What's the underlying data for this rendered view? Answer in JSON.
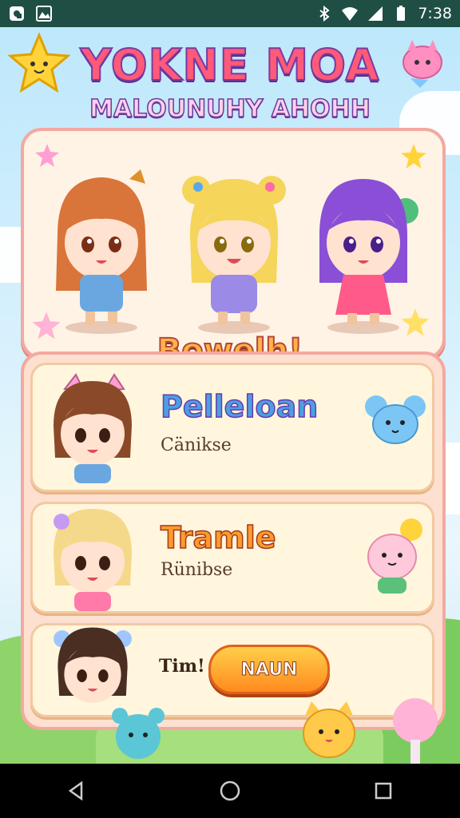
{
  "status_bar": {
    "time": "7:38",
    "icons": [
      "notification-icon",
      "gallery-icon",
      "bluetooth-icon",
      "wifi-icon",
      "signal-icon",
      "battery-icon"
    ]
  },
  "game": {
    "title": "YOKNE MOA",
    "subtitle": "MALOUNUHY AHOHH",
    "banner": "Bowelh!",
    "cards": [
      {
        "title": "Pelleloan",
        "subtitle": "Cänikse"
      },
      {
        "title": "Tramle",
        "subtitle": "Rünibse"
      },
      {
        "label": "Tim!",
        "button": "NAUN"
      }
    ]
  },
  "colors": {
    "accent": "#ff8a1e",
    "panel_border": "#f3a9a0",
    "title_pink": "#ff5a79",
    "title_outline": "#7a3aa1"
  },
  "nav": [
    "back-icon",
    "home-icon",
    "recents-icon"
  ]
}
